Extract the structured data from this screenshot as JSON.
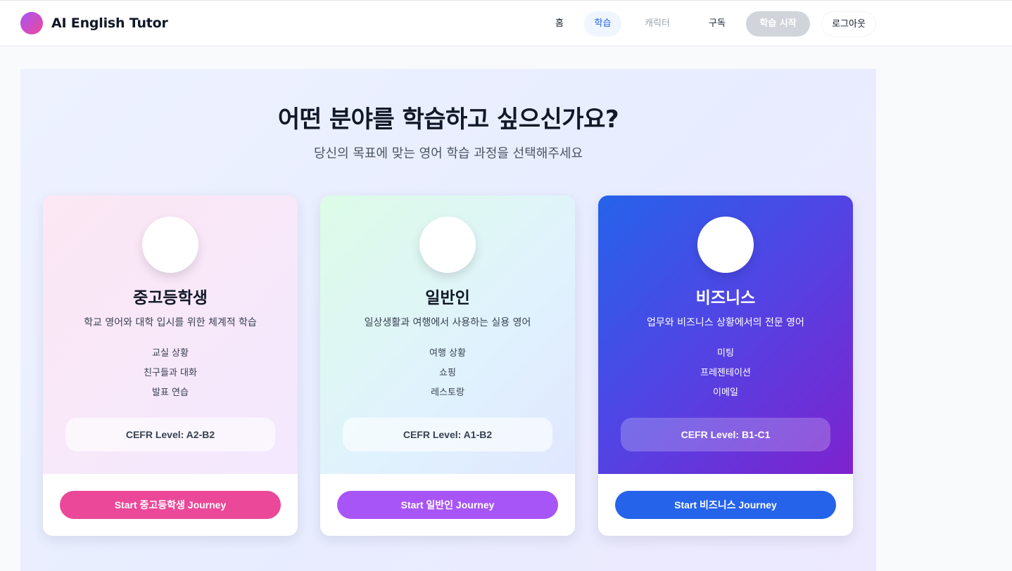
{
  "brand": {
    "name": "AI English Tutor"
  },
  "nav": {
    "items": [
      {
        "label": "홈"
      },
      {
        "label": "학습"
      },
      {
        "label": "캐릭터"
      },
      {
        "label": "구독"
      },
      {
        "label": "학습 시작"
      },
      {
        "label": "로그아웃"
      }
    ]
  },
  "hero": {
    "title": "어떤 분야를 학습하고 싶으신가요?",
    "subtitle": "당신의 목표에 맞는 영어 학습 과정을 선택해주세요"
  },
  "cards": [
    {
      "title": "중고등학생",
      "description": "학교 영어와 대학 입시를 위한 체계적 학습",
      "features": [
        "교실 상황",
        "친구들과 대화",
        "발표 연습"
      ],
      "level": "CEFR Level: A2-B2",
      "button": "Start 중고등학생 Journey"
    },
    {
      "title": "일반인",
      "description": "일상생활과 여행에서 사용하는 실용 영어",
      "features": [
        "여행 상황",
        "쇼핑",
        "레스토랑"
      ],
      "level": "CEFR Level: A1-B2",
      "button": "Start 일반인 Journey"
    },
    {
      "title": "비즈니스",
      "description": "업무와 비즈니스 상황에서의 전문 영어",
      "features": [
        "미팅",
        "프레젠테이션",
        "이메일"
      ],
      "level": "CEFR Level: B1-C1",
      "button": "Start 비즈니스 Journey"
    }
  ],
  "colors": {
    "accent_blue": "#2563eb",
    "pink": "#ec4899",
    "purple": "#a855f7",
    "nav_active_bg": "#eff6ff"
  }
}
